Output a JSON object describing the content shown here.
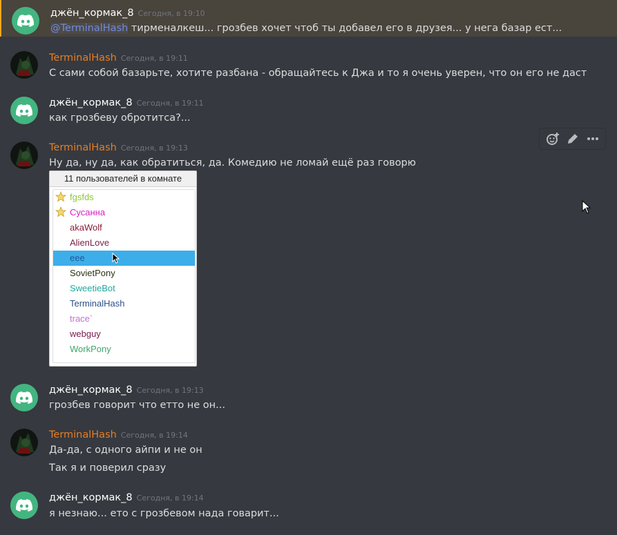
{
  "messages": [
    {
      "author": "джён_кормак_8",
      "time": "Сегодня, в 19:10",
      "mention": "@TerminalHash",
      "text": " тирменалкеш... грозбев хочет чтоб ты добавел его в друзея... у нега базар ест..."
    },
    {
      "author": "TerminalHash",
      "time": "Сегодня, в 19:11",
      "text": "С сами собой базарьте, хотите разбана - обращайтесь к Джа и то я очень уверен, что он его не даст"
    },
    {
      "author": "джён_кормак_8",
      "time": "Сегодня, в 19:11",
      "text": "как грозбеву обротитса?..."
    },
    {
      "author": "TerminalHash",
      "time": "Сегодня, в 19:13",
      "text": "Ну да, ну да, как обратиться, да. Комедию не ломай ещё раз говорю"
    },
    {
      "author": "джён_кормак_8",
      "time": "Сегодня, в 19:13",
      "text": "грозбев говорит что етто не он..."
    },
    {
      "author": "TerminalHash",
      "time": "Сегодня, в 19:14",
      "text": "Да-да, с одного айпи и не он",
      "text2": "Так я и поверил сразу"
    },
    {
      "author": "джён_кормак_8",
      "time": "Сегодня, в 19:14",
      "text": "я незнаю... ето с грозбевом нада говарит..."
    }
  ],
  "toolbar": {
    "icons": [
      "add-reaction-icon",
      "edit-icon",
      "more-icon"
    ]
  },
  "userlist": {
    "title": "11 пользователей в комнате",
    "users": [
      {
        "name": "fgsfds",
        "color": "#8dc83b",
        "star": true
      },
      {
        "name": "Сусанна",
        "color": "#d81fc7",
        "star": true
      },
      {
        "name": "akaWolf",
        "color": "#8a1d3a",
        "star": false
      },
      {
        "name": "AlienLove",
        "color": "#7a1c44",
        "star": false
      },
      {
        "name": "eee",
        "color": "#1e5a9a",
        "star": false,
        "selected": true
      },
      {
        "name": "SovietPony",
        "color": "#2a3412",
        "star": false
      },
      {
        "name": "SweetieBot",
        "color": "#22a89c",
        "star": false
      },
      {
        "name": "TerminalHash",
        "color": "#2e4f88",
        "star": false
      },
      {
        "name": "trace`",
        "color": "#c46fd4",
        "star": false
      },
      {
        "name": "webguy",
        "color": "#7a1a50",
        "star": false
      },
      {
        "name": "WorkPony",
        "color": "#3da66a",
        "star": false
      }
    ]
  },
  "colors": {
    "background": "#36393f",
    "mention_highlight": "#49443c",
    "mention_border": "#faa61a",
    "discord_green": "#43b581",
    "selection": "#3daee9"
  }
}
